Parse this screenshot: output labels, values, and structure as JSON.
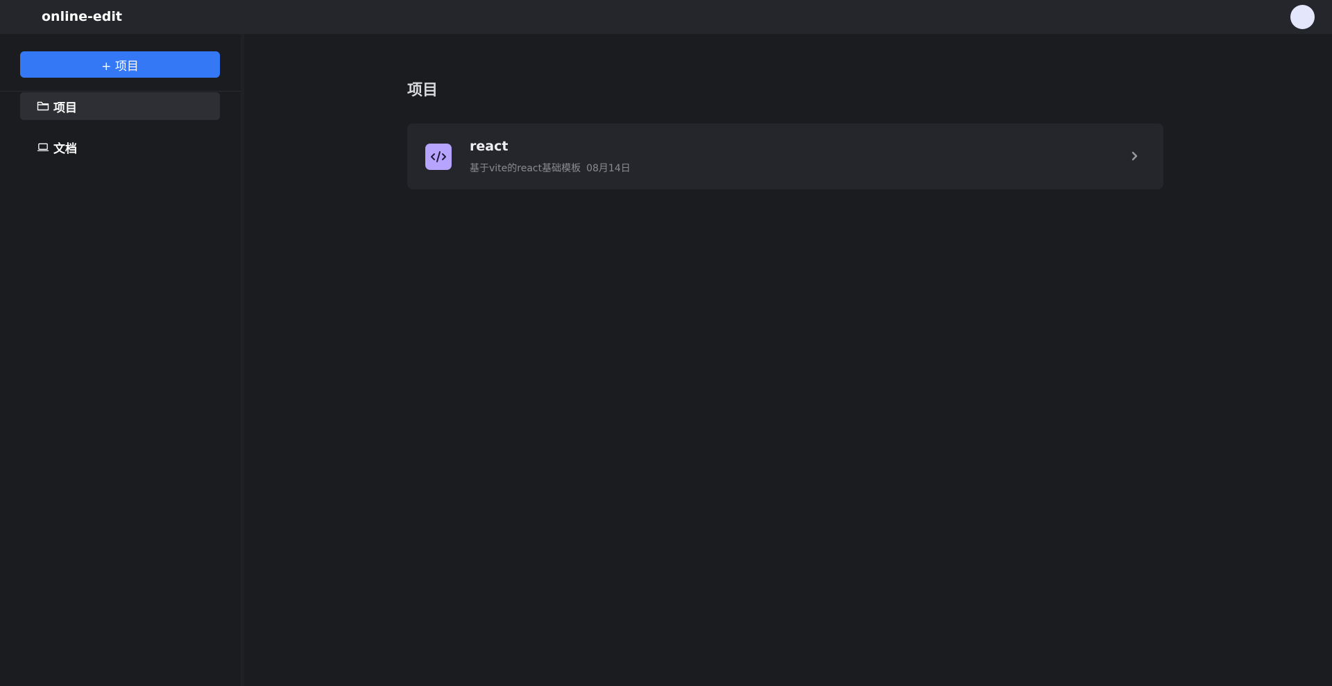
{
  "header": {
    "app_title": "online-edit"
  },
  "sidebar": {
    "new_project_label": "+ 项目",
    "items": [
      {
        "label": "项目",
        "icon": "folder-icon",
        "active": true
      },
      {
        "label": "文档",
        "icon": "laptop-icon",
        "active": false
      }
    ]
  },
  "main": {
    "heading": "项目",
    "projects": [
      {
        "name": "react",
        "description": "基于vite的react基础模板",
        "date": "08月14日",
        "icon": "code-icon"
      }
    ]
  },
  "colors": {
    "accent": "#3478f6",
    "project_icon_bg": "#b7a4ff",
    "background": "#1b1c20",
    "card": "#25262b"
  }
}
